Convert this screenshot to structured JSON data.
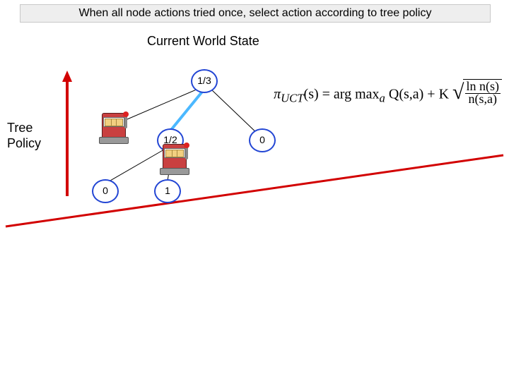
{
  "title": "When all node actions tried once, select action according to tree policy",
  "subtitle": "Current World State",
  "side_label_line1": "Tree",
  "side_label_line2": "Policy",
  "nodes": {
    "root": "1/3",
    "mid": "1/2",
    "right": "0",
    "leaf_left": "0",
    "leaf_right": "1"
  },
  "formula": {
    "lhs": "π",
    "sub": "UCT",
    "arg": "(s) = arg max",
    "argsub": "a",
    "q": " Q(s,a) + K",
    "num": "ln n(s)",
    "den": "n(s,a)"
  }
}
